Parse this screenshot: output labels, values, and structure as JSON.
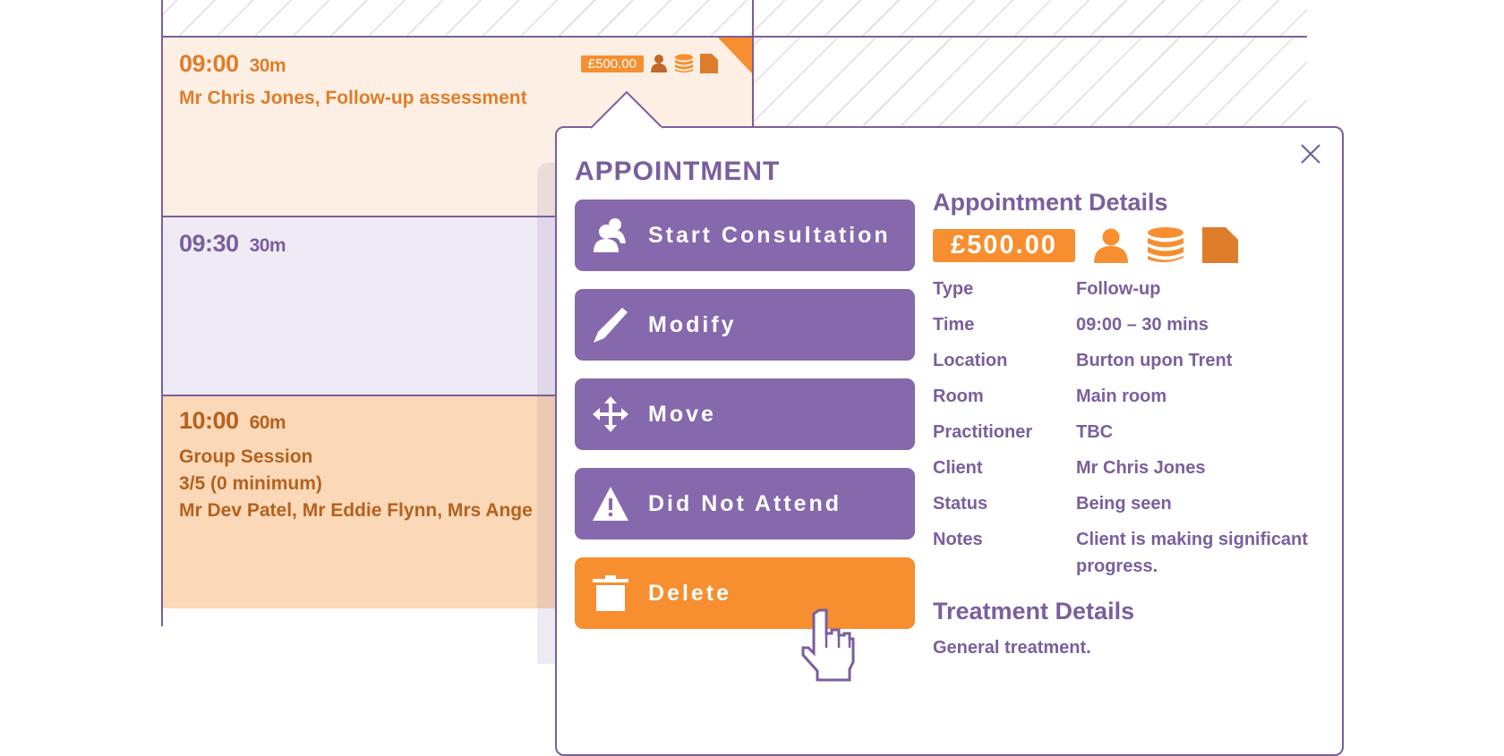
{
  "calendar": {
    "slots": [
      {
        "time": "09:00",
        "duration": "30m",
        "line1": "Mr Chris Jones, Follow-up assessment",
        "price": "£500.00",
        "icons": [
          "person-icon",
          "coins-icon",
          "file-icon"
        ],
        "color": "#de7d2b"
      },
      {
        "time": "09:30",
        "duration": "30m",
        "color": "#7a5f9d"
      },
      {
        "time": "10:00",
        "duration": "60m",
        "line1": "Group Session",
        "line2": "3/5 (0 minimum)",
        "line3": "Mr Dev Patel, Mr Eddie Flynn, Mrs Ange",
        "color": "#b4621f"
      }
    ]
  },
  "popup": {
    "title": "APPOINTMENT",
    "close_label": "Close",
    "actions": [
      {
        "label": "Start Consultation",
        "icon": "consultation-icon"
      },
      {
        "label": "Modify",
        "icon": "pencil-icon"
      },
      {
        "label": "Move",
        "icon": "move-icon"
      },
      {
        "label": "Did Not Attend",
        "icon": "warning-icon"
      },
      {
        "label": "Delete",
        "icon": "trash-icon"
      }
    ],
    "details": {
      "heading": "Appointment Details",
      "price": "£500.00",
      "rows": [
        {
          "key": "Type",
          "value": "Follow-up"
        },
        {
          "key": "Time",
          "value": "09:00 – 30 mins"
        },
        {
          "key": "Location",
          "value": "Burton upon Trent"
        },
        {
          "key": "Room",
          "value": "Main room"
        },
        {
          "key": "Practitioner",
          "value": "TBC"
        },
        {
          "key": "Client",
          "value": "Mr Chris Jones"
        },
        {
          "key": "Status",
          "value": "Being seen"
        },
        {
          "key": "Notes",
          "value": "Client is making significant progress."
        }
      ]
    },
    "treatment": {
      "heading": "Treatment Details",
      "text": "General treatment."
    }
  },
  "colors": {
    "accent_purple": "#7a5f9d",
    "button_purple": "#8668ad",
    "accent_orange": "#f78e2f"
  }
}
